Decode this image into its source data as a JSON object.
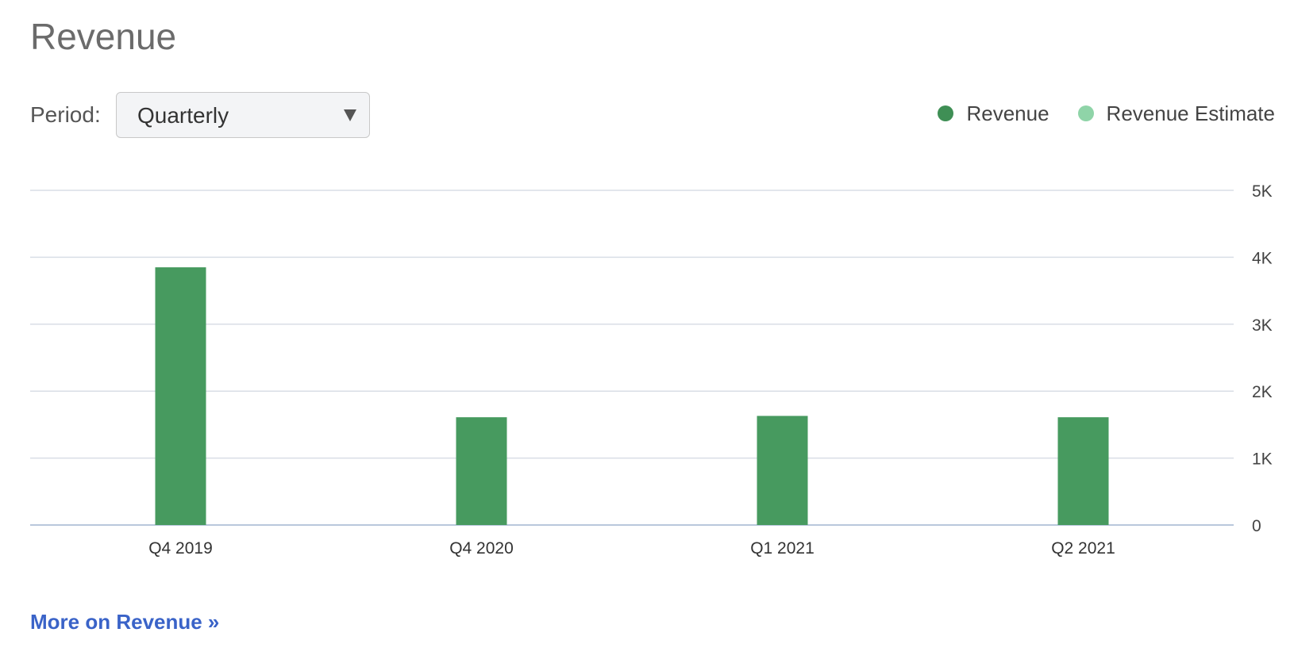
{
  "header": {
    "title": "Revenue"
  },
  "controls": {
    "period_label": "Period:",
    "period_value": "Quarterly"
  },
  "legend": [
    {
      "label": "Revenue",
      "color": "#3f8f55"
    },
    {
      "label": "Revenue Estimate",
      "color": "#8fd4a8"
    }
  ],
  "footer": {
    "more_link": "More on Revenue »"
  },
  "chart_data": {
    "type": "bar",
    "categories": [
      "Q4 2019",
      "Q4 2020",
      "Q1 2021",
      "Q2 2021"
    ],
    "series": [
      {
        "name": "Revenue",
        "values": [
          3850,
          1610,
          1630,
          1610
        ],
        "color": "#479a5f"
      }
    ],
    "ylim": [
      0,
      5000
    ],
    "yticks": [
      0,
      1000,
      2000,
      3000,
      4000,
      5000
    ],
    "ytick_labels": [
      "0",
      "1K",
      "2K",
      "3K",
      "4K",
      "5K"
    ],
    "y_axis_position": "right",
    "grid": true,
    "legend_position": "top-right"
  }
}
